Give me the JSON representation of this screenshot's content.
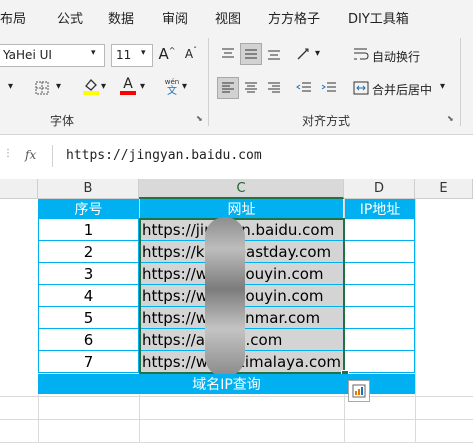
{
  "menu": [
    "布局",
    "公式",
    "数据",
    "审阅",
    "视图",
    "方方格子",
    "DIY工具箱"
  ],
  "ribbon": {
    "font_name": "YaHei UI",
    "font_size": "11",
    "grow_font_glyph": "A",
    "shrink_font_glyph": "A",
    "phonetic_top": "wén",
    "phonetic_bottom": "文",
    "font_color_glyph": "A",
    "wrap_text_label": "自动换行",
    "merge_center_label": "合并后居中",
    "font_group_label": "字体",
    "align_group_label": "对齐方式",
    "highlight_color": "#ffff00",
    "font_color": "#ff0000"
  },
  "formula_bar": {
    "fx_label": "fx",
    "value": "https://jingyan.baidu.com"
  },
  "sheet": {
    "columns": [
      "B",
      "C",
      "D",
      "E"
    ],
    "active_column": "C",
    "table_header": {
      "seq": "序号",
      "url": "网址",
      "ip": "IP地址"
    },
    "rows": [
      {
        "seq": "1",
        "url": "https://jingyan.baidu.com"
      },
      {
        "seq": "2",
        "url": "https://kaifa.eastday.com"
      },
      {
        "seq": "3",
        "url": "https://www.douyin.com"
      },
      {
        "seq": "4",
        "url": "https://www.douyin.com"
      },
      {
        "seq": "5",
        "url": "https://www.anmar.com"
      },
      {
        "seq": "6",
        "url": "https://anjuke.com"
      },
      {
        "seq": "7",
        "url": "https://www.ximalaya.com"
      }
    ],
    "footer": "域名IP查询",
    "header_fill": "#00b0f0",
    "selection_fill": "#d4d4d4",
    "selection_border": "#217346"
  }
}
